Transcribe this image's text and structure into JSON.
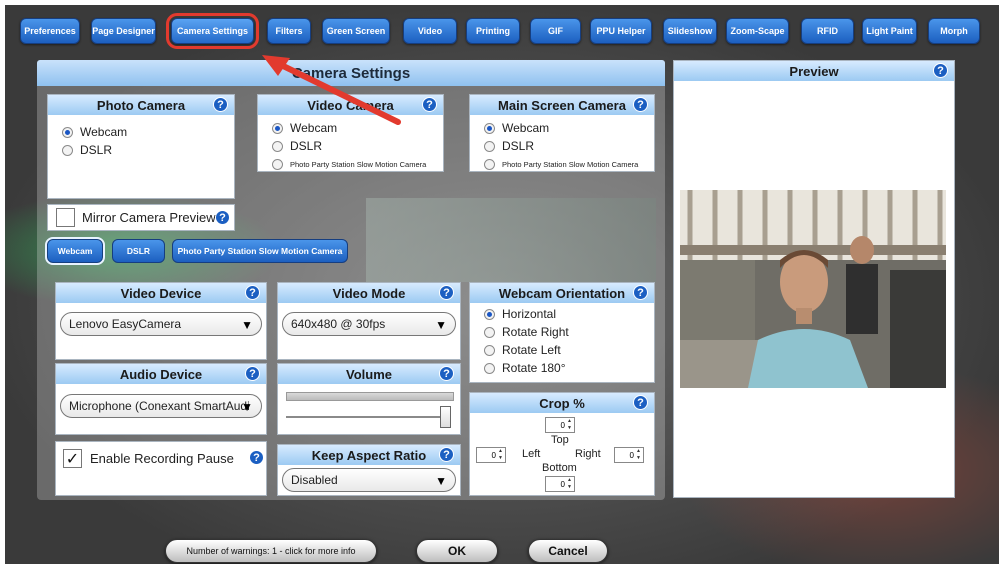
{
  "toolbar": {
    "buttons": [
      "Preferences",
      "Page Designer",
      "Camera Settings",
      "Filters",
      "Green Screen",
      "Video",
      "Printing",
      "GIF",
      "PPU Helper",
      "Slideshow",
      "Zoom-Scape",
      "RFID",
      "Light Paint",
      "Morph"
    ],
    "active_index": 2
  },
  "panel_title": "Camera Settings",
  "help_glyph": "?",
  "photo_camera": {
    "title": "Photo Camera",
    "options": [
      "Webcam",
      "DSLR"
    ],
    "selected": 0
  },
  "video_camera": {
    "title": "Video Camera",
    "options": [
      "Webcam",
      "DSLR",
      "Photo Party Station Slow Motion Camera"
    ],
    "selected": 0
  },
  "main_screen_camera": {
    "title": "Main Screen Camera",
    "options": [
      "Webcam",
      "DSLR",
      "Photo Party Station Slow Motion Camera"
    ],
    "selected": 0
  },
  "mirror_preview": {
    "label": "Mirror Camera Preview",
    "checked": false
  },
  "camera_tabs": [
    "Webcam",
    "DSLR",
    "Photo Party Station Slow Motion Camera"
  ],
  "video_device": {
    "title": "Video Device",
    "value": "Lenovo EasyCamera"
  },
  "video_mode": {
    "title": "Video Mode",
    "value": "640x480 @ 30fps"
  },
  "webcam_orientation": {
    "title": "Webcam Orientation",
    "options": [
      "Horizontal",
      "Rotate Right",
      "Rotate Left",
      "Rotate 180°"
    ],
    "selected": 0
  },
  "audio_device": {
    "title": "Audio Device",
    "value": "Microphone (Conexant SmartAudi"
  },
  "volume": {
    "title": "Volume"
  },
  "crop": {
    "title": "Crop %",
    "top_label": "Top",
    "left_label": "Left",
    "right_label": "Right",
    "bottom_label": "Bottom",
    "top": "0",
    "left": "0",
    "right": "0",
    "bottom": "0"
  },
  "recording_pause": {
    "label": "Enable Recording Pause",
    "checked": true,
    "check_glyph": "✓"
  },
  "keep_aspect": {
    "title": "Keep Aspect Ratio",
    "value": "Disabled"
  },
  "preview": {
    "title": "Preview"
  },
  "caret_glyph": "▼",
  "footer": {
    "warnings": "Number of warnings: 1 - click for more info",
    "ok": "OK",
    "cancel": "Cancel"
  },
  "colors": {
    "accent": "#1c5fc0",
    "header": "#9ccaf2",
    "highlight": "#e23a2e"
  }
}
